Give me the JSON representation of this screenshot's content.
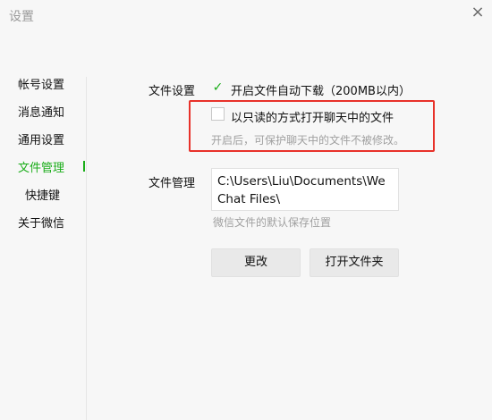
{
  "window": {
    "title": "设置",
    "close_glyph": "×"
  },
  "sidebar": {
    "items": [
      {
        "label": "帐号设置"
      },
      {
        "label": "消息通知"
      },
      {
        "label": "通用设置"
      },
      {
        "label": "文件管理"
      },
      {
        "label": "快捷键"
      },
      {
        "label": "关于微信"
      }
    ]
  },
  "file_settings": {
    "label": "文件设置",
    "auto_download": {
      "label": "开启文件自动下载（200MB以内）",
      "checked": true,
      "check_glyph": "✓"
    },
    "readonly_open": {
      "label": "以只读的方式打开聊天中的文件",
      "checked": false
    },
    "readonly_hint": "开启后，可保护聊天中的文件不被修改。"
  },
  "file_management": {
    "label": "文件管理",
    "path": "C:\\Users\\Liu\\Documents\\WeChat Files\\",
    "hint": "微信文件的默认保存位置",
    "change_button": "更改",
    "open_folder_button": "打开文件夹"
  },
  "colors": {
    "accent": "#1aad19",
    "highlight_box": "#e8322a",
    "hint_text": "#a0a0a0"
  }
}
